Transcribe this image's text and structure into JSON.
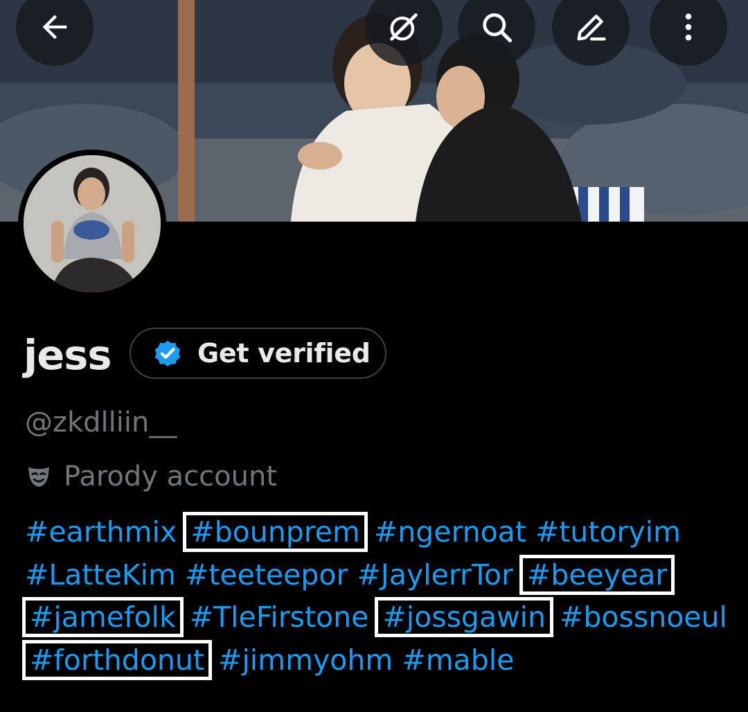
{
  "profile": {
    "display_name": "jess",
    "handle": "@zkdlliin__",
    "account_label": "Parody account",
    "verify_button_label": "Get verified"
  },
  "icons": {
    "back": "arrow-left-icon",
    "grok": "grok-icon",
    "search": "search-icon",
    "edit": "pencil-icon",
    "more": "more-vertical-icon",
    "verified_badge": "verified-badge-icon",
    "parody": "mask-icon"
  },
  "bio": {
    "hashtags": [
      {
        "text": "#earthmix",
        "highlighted": false
      },
      {
        "text": "#bounprem",
        "highlighted": true
      },
      {
        "text": "#ngernoat",
        "highlighted": false
      },
      {
        "text": "#tutoryim",
        "highlighted": false
      },
      {
        "text": "#LatteKim",
        "highlighted": false
      },
      {
        "text": "#teeteepor",
        "highlighted": false
      },
      {
        "text": "#JaylerrTor",
        "highlighted": false
      },
      {
        "text": "#beeyear",
        "highlighted": true
      },
      {
        "text": "#jamefolk",
        "highlighted": true
      },
      {
        "text": "#TleFirstone",
        "highlighted": false
      },
      {
        "text": "#jossgawin",
        "highlighted": true
      },
      {
        "text": "#bossnoeul",
        "highlighted": false
      },
      {
        "text": "#forthdonut",
        "highlighted": true
      },
      {
        "text": "#jimmyohm",
        "highlighted": false
      },
      {
        "text": "#mable",
        "highlighted": false
      }
    ]
  },
  "colors": {
    "background": "#000000",
    "link": "#1d9bf0",
    "secondary_text": "#71767b",
    "primary_text": "#e7e9ea",
    "highlight_box": "#ffffff"
  }
}
